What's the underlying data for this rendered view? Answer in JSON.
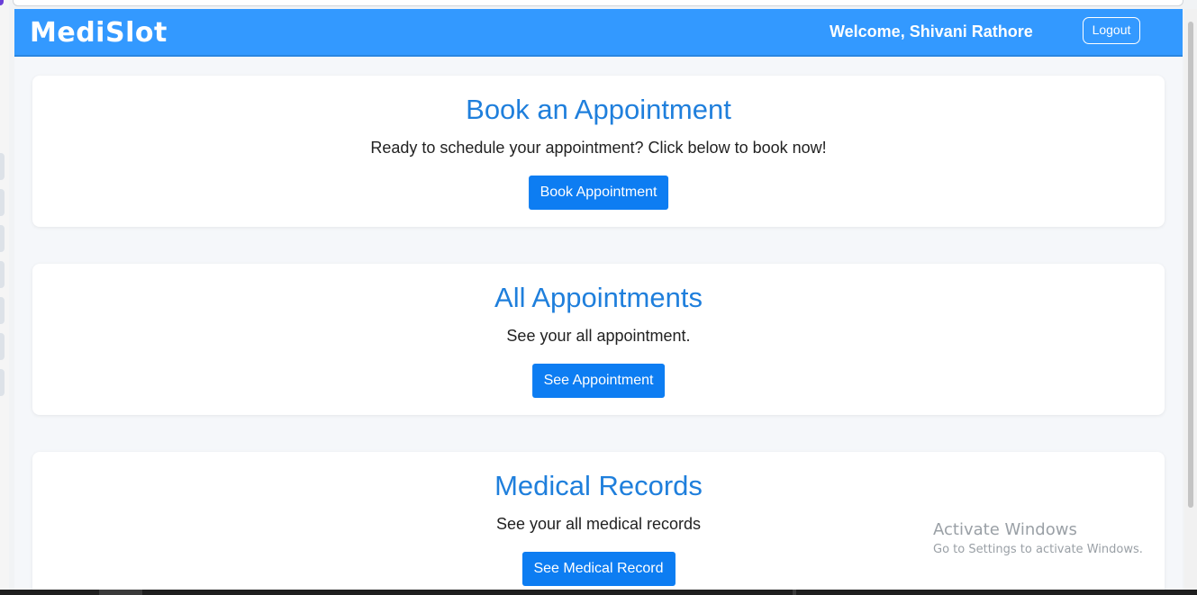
{
  "header": {
    "brand": "MediSlot",
    "welcome": "Welcome, Shivani Rathore",
    "logout_label": "Logout"
  },
  "cards": [
    {
      "title": "Book an Appointment",
      "description": "Ready to schedule your appointment? Click below to book now!",
      "button_label": "Book Appointment"
    },
    {
      "title": "All Appointments",
      "description": "See your all appointment.",
      "button_label": "See Appointment"
    },
    {
      "title": "Medical Records",
      "description": "See your all medical records",
      "button_label": "See Medical Record"
    }
  ],
  "watermark": {
    "line1": "Activate Windows",
    "line2": "Go to Settings to activate Windows."
  },
  "colors": {
    "header_bg": "#3399ff",
    "title": "#1f7fdc",
    "button_bg": "#0d7df2"
  }
}
